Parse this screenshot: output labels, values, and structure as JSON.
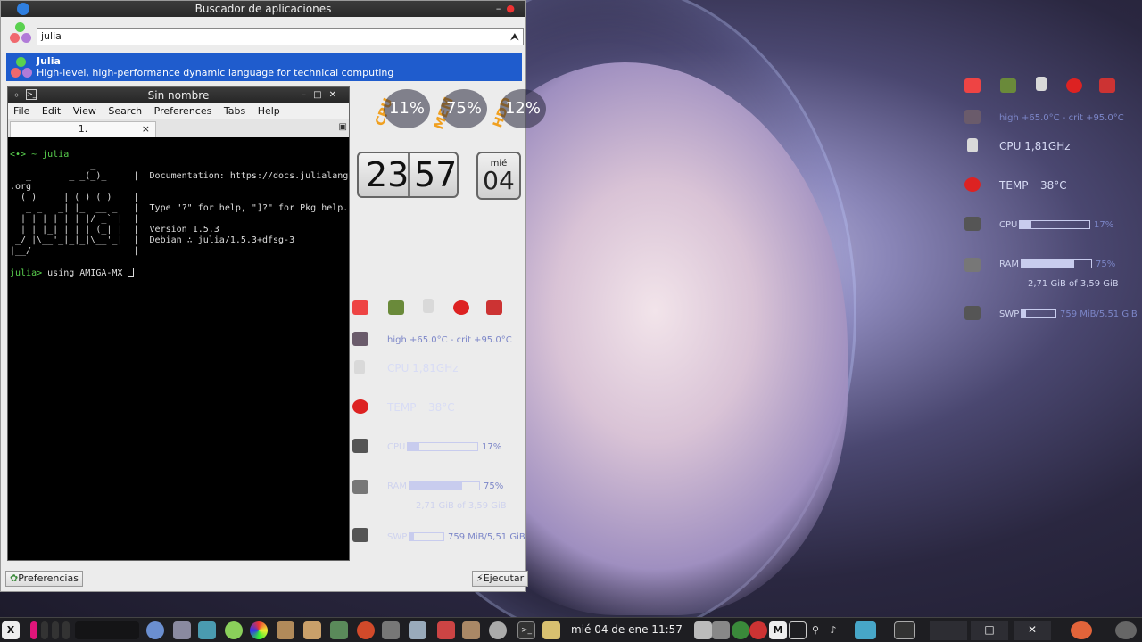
{
  "finder": {
    "title": "Buscador de aplicaciones",
    "title_controls": "– ",
    "search_value": "julia",
    "result_name": "Julia",
    "result_desc": "High-level, high-performance dynamic language for technical computing",
    "prefs_label": "Preferencias",
    "run_label": "Ejecutar"
  },
  "terminal": {
    "title": "Sin nombre",
    "menu": [
      "File",
      "Edit",
      "View",
      "Search",
      "Preferences",
      "Tabs",
      "Help"
    ],
    "tab_label": "1.",
    "tab_close": "×",
    "lines": [
      "<•> ~ julia",
      "               _",
      "   _       _ _(_)_     |  Documentation: https://docs.julialang",
      ".org",
      "  (_)     | (_) (_)    |",
      "   _ _   _| |_  __ _   |  Type \"?\" for help, \"]?\" for Pkg help.",
      "  | | | | | | |/ _` |  |",
      "  | | |_| | | | (_| |  |  Version 1.5.3",
      " _/ |\\__'_|_|_|\\__'_|  |  Debian ∴ julia/1.5.3+dfsg-3",
      "|__/                   |",
      ""
    ],
    "prompt": "julia> ",
    "input": "using AMIGA-MX "
  },
  "gauges": {
    "cpu_label": "CPU",
    "cpu_value": "11%",
    "mem_label": "MEM",
    "mem_value": "75%",
    "hdd_label": "HDD",
    "hdd_value": "12%"
  },
  "clock": {
    "hours": "23",
    "minutes": "57",
    "weekday": "mié",
    "day": "04"
  },
  "conky": {
    "temp_range": "high +65.0°C - crit +95.0°C",
    "cpu_freq": "CPU 1,81GHz",
    "temp_label": "TEMP",
    "temp_value": "38°C",
    "cpu_label": "CPU",
    "cpu_pct": "17%",
    "cpu_level": 0.17,
    "ram_label": "RAM",
    "ram_pct": "75%",
    "ram_level": 0.75,
    "ram_detail": "2,71 GiB of 3,59 GiB",
    "swp_label": "SWP",
    "swp_detail": "759 MiB/5,51 GiB",
    "swp_level": 0.14
  },
  "taskbar": {
    "clock": "mié 04 de ene  11:57",
    "btn_min": "–",
    "btn_max": "□",
    "btn_close": "✕"
  }
}
